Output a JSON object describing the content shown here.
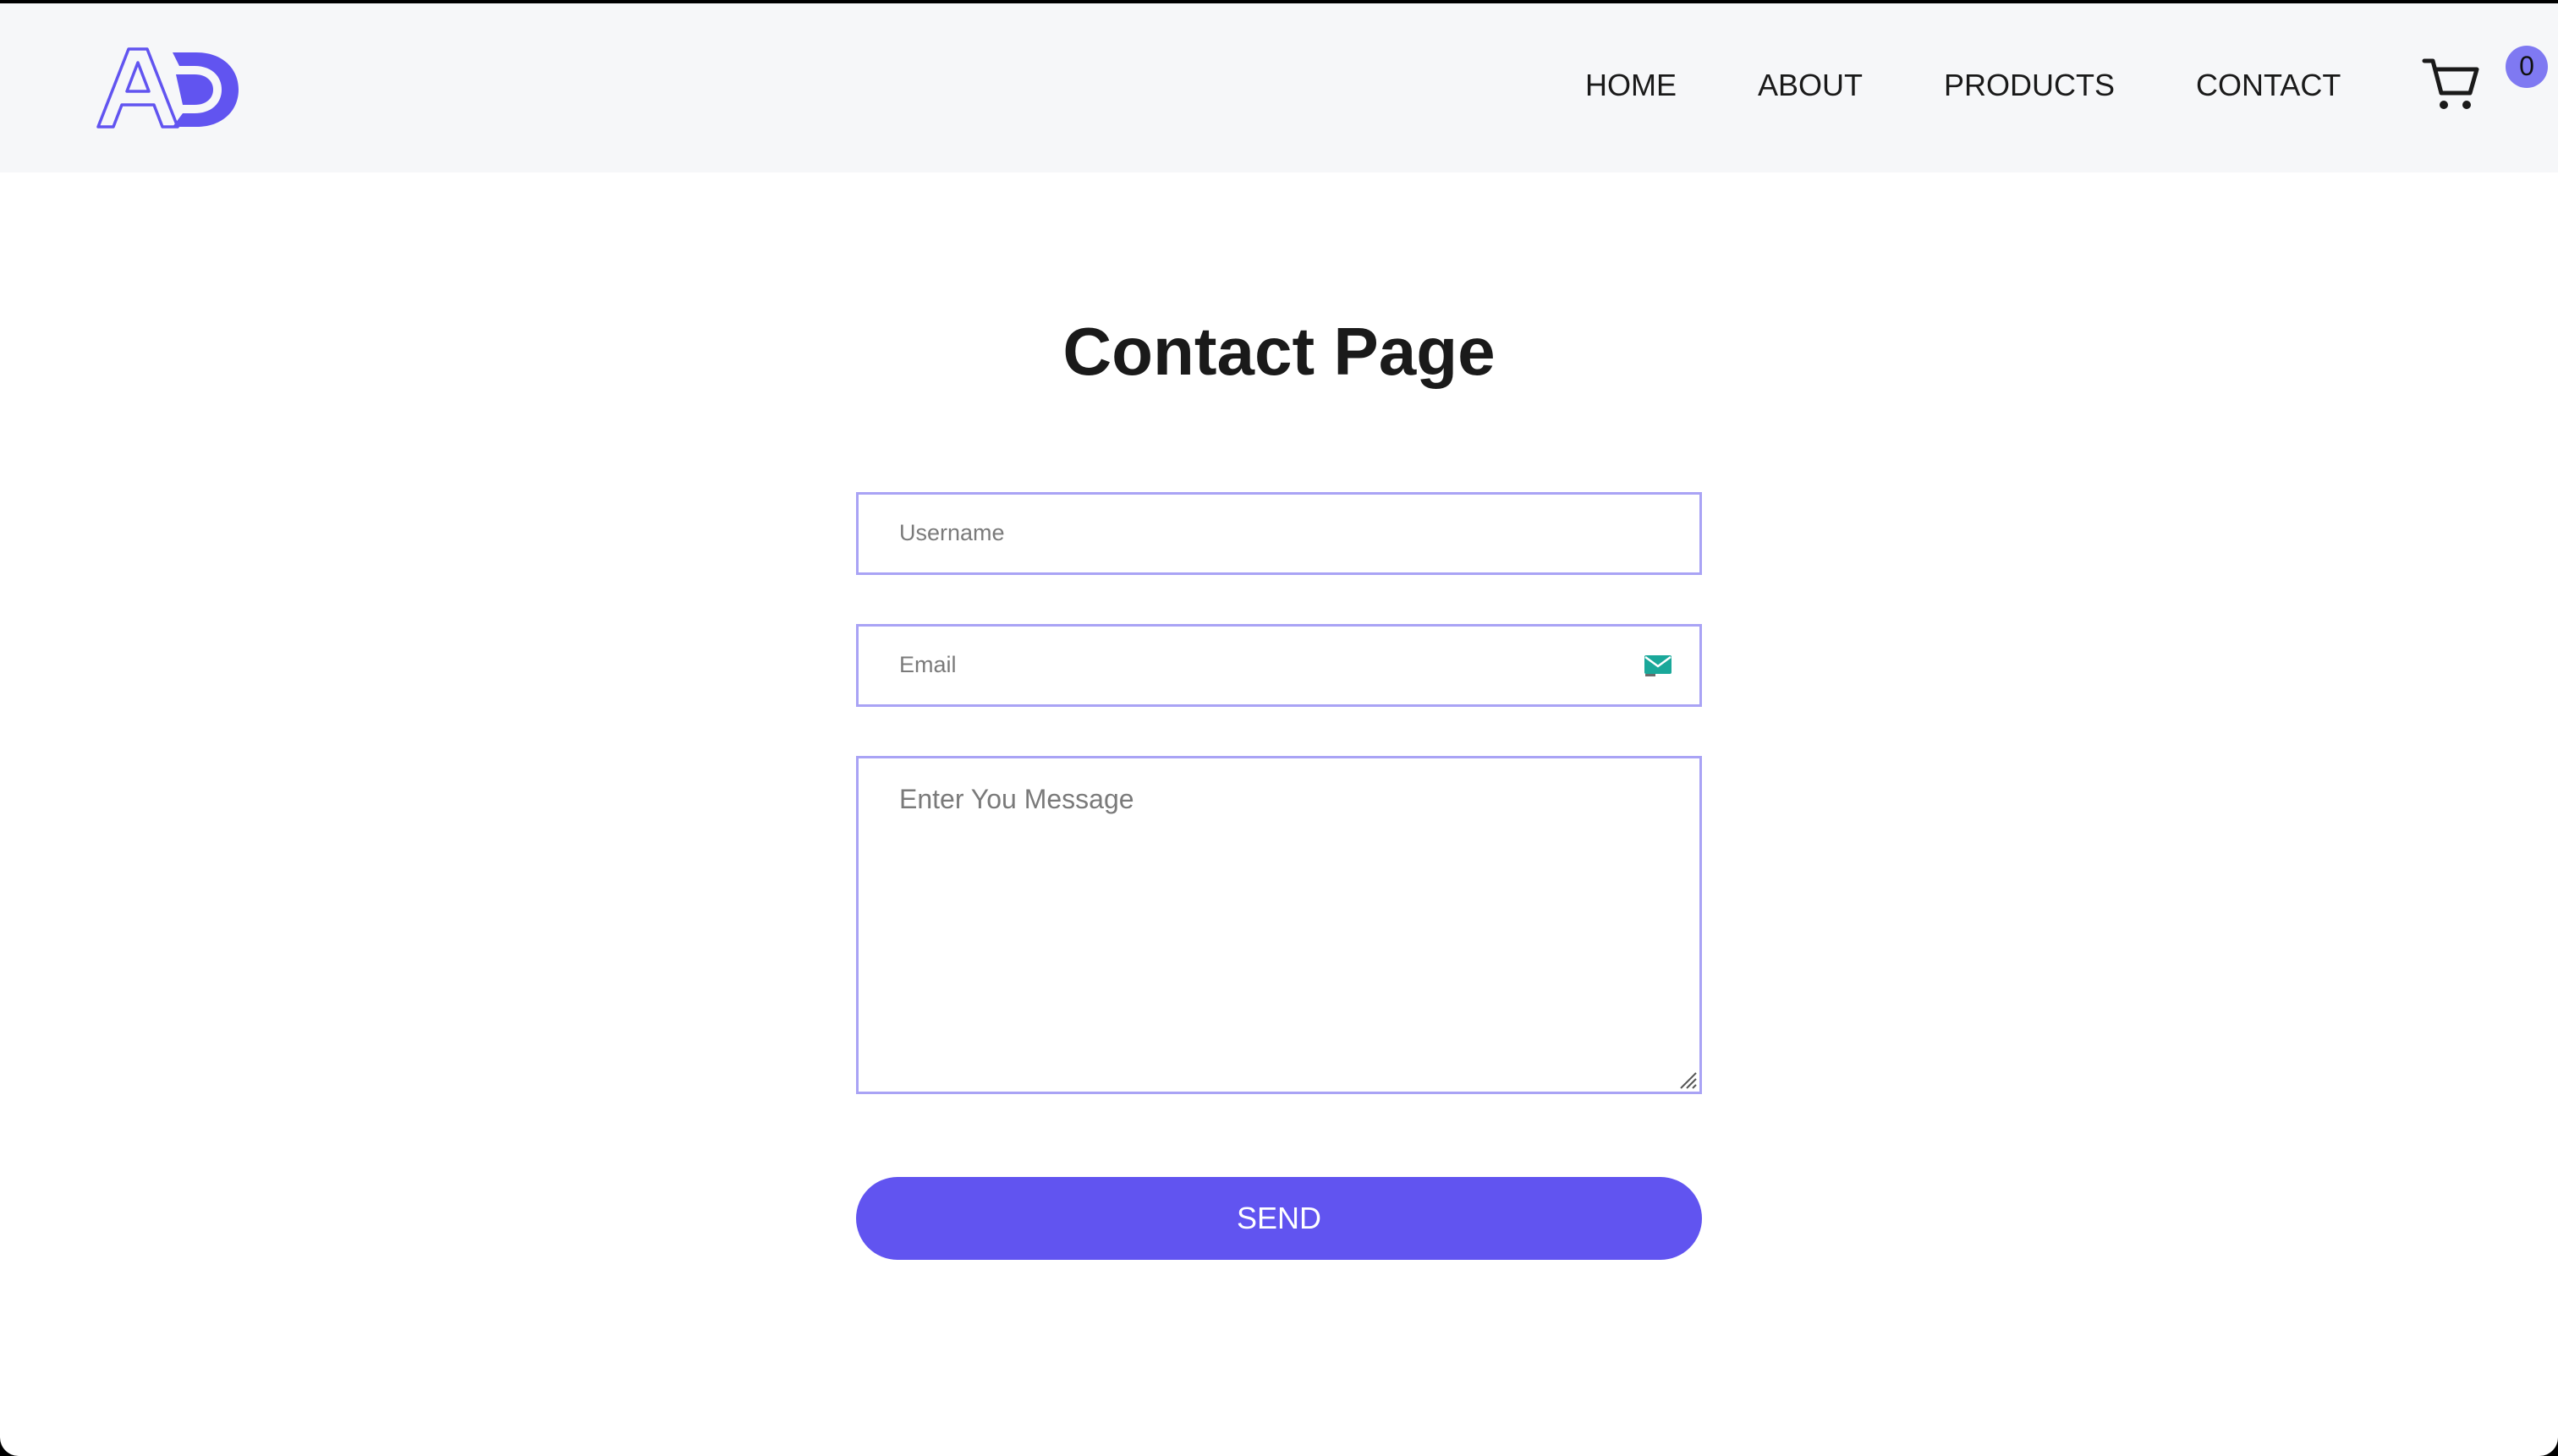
{
  "nav": {
    "links": [
      {
        "label": "HOME"
      },
      {
        "label": "ABOUT"
      },
      {
        "label": "PRODUCTS"
      },
      {
        "label": "CONTACT"
      }
    ],
    "cart_count": "0"
  },
  "logo": {
    "icon": "ad-logo",
    "text": "AD"
  },
  "page": {
    "title": "Contact Page"
  },
  "form": {
    "username_placeholder": "Username",
    "email_placeholder": "Email",
    "message_placeholder": "Enter You Message",
    "send_label": "SEND"
  },
  "colors": {
    "accent": "#6154f0",
    "navbar_bg": "#f6f7f9",
    "field_border": "#a9a3f5",
    "badge": "#7f79f2"
  }
}
